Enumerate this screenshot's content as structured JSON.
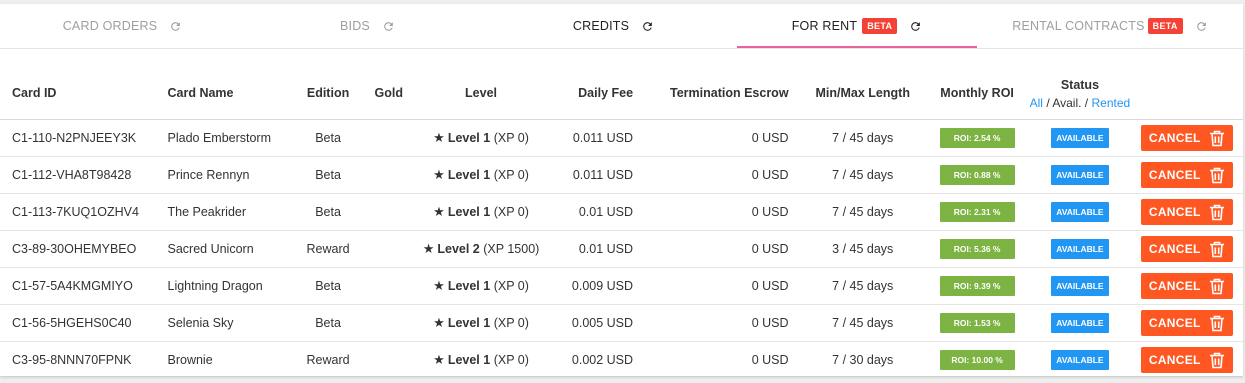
{
  "tabs": [
    {
      "label": "CARD ORDERS",
      "beta": "",
      "refresh_icon": "refresh-icon"
    },
    {
      "label": "BIDS",
      "beta": "",
      "refresh_icon": "refresh-icon"
    },
    {
      "label": "CREDITS",
      "beta": "",
      "refresh_icon": "refresh-icon"
    },
    {
      "label": "FOR RENT",
      "beta": "BETA",
      "refresh_icon": "refresh-icon"
    },
    {
      "label": "RENTAL CONTRACTS",
      "beta": "BETA",
      "refresh_icon": "refresh-icon"
    }
  ],
  "active_tab": "FOR RENT",
  "colors": {
    "accent_underline": "#e8629b",
    "beta": "#f44336",
    "roi": "#7cb342",
    "available": "#2196f3",
    "cancel": "#ff5722",
    "link": "#2196f3"
  },
  "table": {
    "headers": {
      "card_id": "Card ID",
      "card_name": "Card Name",
      "edition": "Edition",
      "gold": "Gold",
      "level": "Level",
      "daily_fee": "Daily Fee",
      "termination_escrow": "Termination Escrow",
      "min_max_length": "Min/Max Length",
      "monthly_roi": "Monthly ROI",
      "status": "Status"
    },
    "status_filter": {
      "all": "All",
      "sep1": " / ",
      "avail": "Avail.",
      "sep2": " / ",
      "rented": "Rented"
    },
    "rows": [
      {
        "card_id": "C1-110-N2PNJEEY3K",
        "card_name": "Plado Emberstorm",
        "edition": "Beta",
        "gold": "",
        "level": "Level 1",
        "xp": "(XP 0)",
        "daily_fee": "0.011 USD",
        "escrow": "0 USD",
        "length": "7 / 45 days",
        "roi": "ROI: 2.54 %",
        "status": "AVAILABLE",
        "action": "CANCEL"
      },
      {
        "card_id": "C1-112-VHA8T98428",
        "card_name": "Prince Rennyn",
        "edition": "Beta",
        "gold": "",
        "level": "Level 1",
        "xp": "(XP 0)",
        "daily_fee": "0.011 USD",
        "escrow": "0 USD",
        "length": "7 / 45 days",
        "roi": "ROI: 0.88 %",
        "status": "AVAILABLE",
        "action": "CANCEL"
      },
      {
        "card_id": "C1-113-7KUQ1OZHV4",
        "card_name": "The Peakrider",
        "edition": "Beta",
        "gold": "",
        "level": "Level 1",
        "xp": "(XP 0)",
        "daily_fee": "0.01 USD",
        "escrow": "0 USD",
        "length": "7 / 45 days",
        "roi": "ROI: 2.31 %",
        "status": "AVAILABLE",
        "action": "CANCEL"
      },
      {
        "card_id": "C3-89-30OHEMYBEO",
        "card_name": "Sacred Unicorn",
        "edition": "Reward",
        "gold": "",
        "level": "Level 2",
        "xp": "(XP 1500)",
        "daily_fee": "0.01 USD",
        "escrow": "0 USD",
        "length": "3 / 45 days",
        "roi": "ROI: 5.36 %",
        "status": "AVAILABLE",
        "action": "CANCEL"
      },
      {
        "card_id": "C1-57-5A4KMGMIYO",
        "card_name": "Lightning Dragon",
        "edition": "Beta",
        "gold": "",
        "level": "Level 1",
        "xp": "(XP 0)",
        "daily_fee": "0.009 USD",
        "escrow": "0 USD",
        "length": "7 / 45 days",
        "roi": "ROI: 9.39 %",
        "status": "AVAILABLE",
        "action": "CANCEL"
      },
      {
        "card_id": "C1-56-5HGEHS0C40",
        "card_name": "Selenia Sky",
        "edition": "Beta",
        "gold": "",
        "level": "Level 1",
        "xp": "(XP 0)",
        "daily_fee": "0.005 USD",
        "escrow": "0 USD",
        "length": "7 / 45 days",
        "roi": "ROI: 1.53 %",
        "status": "AVAILABLE",
        "action": "CANCEL"
      },
      {
        "card_id": "C3-95-8NNN70FPNK",
        "card_name": "Brownie",
        "edition": "Reward",
        "gold": "",
        "level": "Level 1",
        "xp": "(XP 0)",
        "daily_fee": "0.002 USD",
        "escrow": "0 USD",
        "length": "7 / 30 days",
        "roi": "ROI: 10.00 %",
        "status": "AVAILABLE",
        "action": "CANCEL"
      }
    ]
  }
}
